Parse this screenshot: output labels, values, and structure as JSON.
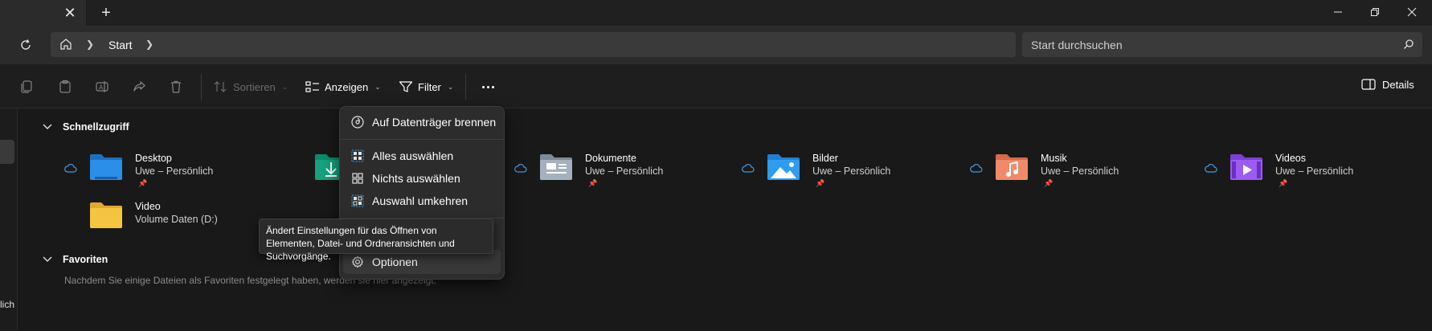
{
  "titlebar": {
    "tab_close": "✕",
    "new_tab": "+"
  },
  "address": {
    "crumb": "Start",
    "search_placeholder": "Start durchsuchen"
  },
  "toolbar": {
    "sort_label": "Sortieren",
    "view_label": "Anzeigen",
    "filter_label": "Filter",
    "details_label": "Details"
  },
  "quick_access": {
    "title": "Schnellzugriff",
    "items": [
      {
        "name": "Desktop",
        "sub": "Uwe – Persönlich",
        "icon": "desktop-folder-icon"
      },
      {
        "name": "",
        "sub": "",
        "icon": "downloads-folder-icon"
      },
      {
        "name": "Dokumente",
        "sub": "Uwe – Persönlich",
        "icon": "documents-folder-icon"
      },
      {
        "name": "Bilder",
        "sub": "Uwe – Persönlich",
        "icon": "pictures-folder-icon"
      },
      {
        "name": "Musik",
        "sub": "Uwe – Persönlich",
        "icon": "music-folder-icon"
      },
      {
        "name": "Videos",
        "sub": "Uwe – Persönlich",
        "icon": "videos-folder-icon"
      },
      {
        "name": "Video",
        "sub": "Volume Daten (D:)",
        "icon": "folder-icon"
      }
    ]
  },
  "favorites": {
    "title": "Favoriten",
    "empty_text": "Nachdem Sie einige Dateien als Favoriten festgelegt haben, werden sie hier angezeigt."
  },
  "nav": {
    "partial_text": "lich"
  },
  "menu": {
    "items": [
      {
        "label": "Auf Datenträger brennen",
        "icon": "burn-disc-icon"
      },
      {
        "label": "Alles auswählen",
        "icon": "select-all-icon"
      },
      {
        "label": "Nichts auswählen",
        "icon": "select-none-icon"
      },
      {
        "label": "Auswahl umkehren",
        "icon": "invert-selection-icon"
      },
      {
        "label": "Optionen",
        "icon": "gear-icon"
      }
    ]
  },
  "tooltip": {
    "text": "Ändert Einstellungen für das Öffnen von Elementen, Datei- und Ordneransichten und Suchvorgänge."
  },
  "colors": {
    "background": "#191919",
    "accent_blue": "#3b9fe8",
    "folder_yellow": "#f5c542"
  }
}
